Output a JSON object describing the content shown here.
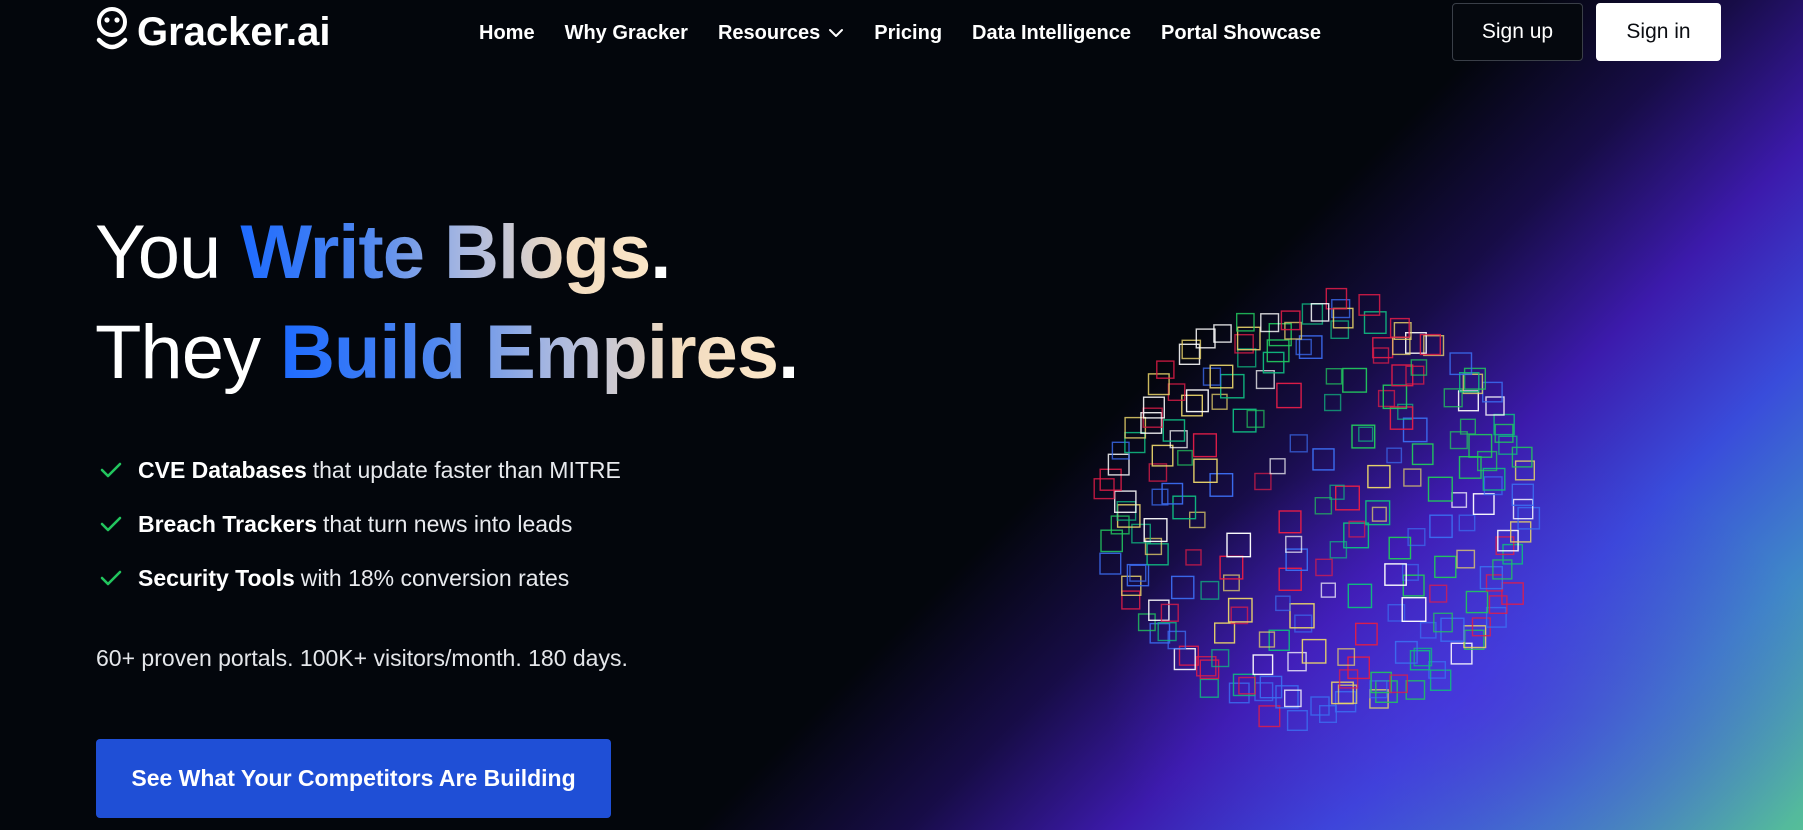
{
  "brand": {
    "name": "Gracker.ai",
    "logo_icon": "smiley-ghost-logo"
  },
  "nav": {
    "items": [
      {
        "label": "Home"
      },
      {
        "label": "Why Gracker"
      },
      {
        "label": "Resources",
        "has_dropdown": true
      },
      {
        "label": "Pricing"
      },
      {
        "label": "Data Intelligence"
      },
      {
        "label": "Portal Showcase"
      }
    ],
    "signup_label": "Sign up",
    "signin_label": "Sign in"
  },
  "hero": {
    "line1": {
      "prefix": "You ",
      "highlight": "Write Blogs",
      "suffix": "."
    },
    "line2": {
      "prefix": "They ",
      "highlight": "Build Empires",
      "suffix": "."
    },
    "features": [
      {
        "bold": "CVE Databases",
        "rest": "that update faster than MITRE"
      },
      {
        "bold": "Breach Trackers",
        "rest": "that turn news into leads"
      },
      {
        "bold": "Security Tools",
        "rest": "with 18% conversion rates"
      }
    ],
    "stats": "60+ proven portals. 100K+ visitors/month. 180 days.",
    "cta_label": "See What Your Competitors Are Building"
  },
  "colors": {
    "background": "#03060c",
    "accent_blue": "#1f4fd6",
    "check_green": "#22c55e",
    "square_palette": [
      "#e11d48",
      "#22c55e",
      "#3b6cf0",
      "#e8d36a",
      "#ffffff",
      "#10b981"
    ]
  }
}
